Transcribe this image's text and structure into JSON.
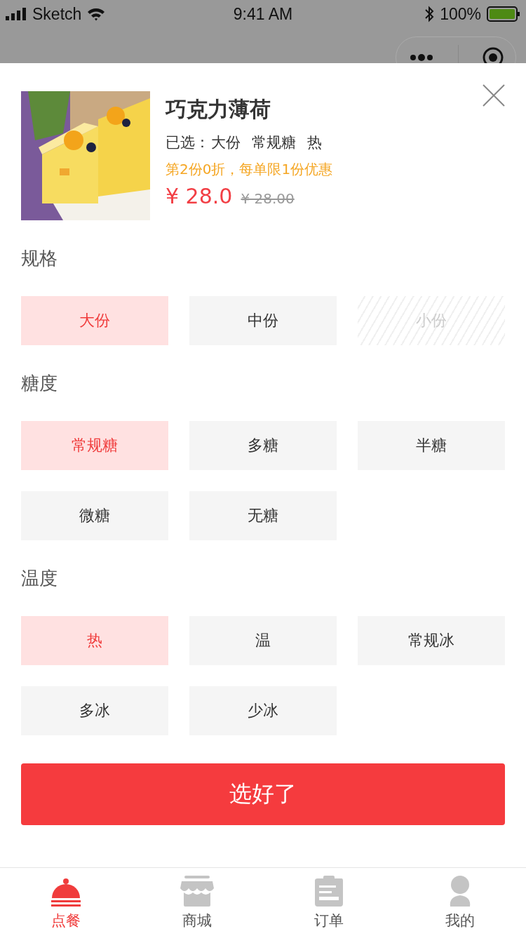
{
  "status_bar": {
    "carrier": "Sketch",
    "time": "9:41 AM",
    "battery": "100%"
  },
  "product": {
    "name": "巧克力薄荷",
    "selected_label": "已选：",
    "selected_options": [
      "大份",
      "常规糖",
      "热"
    ],
    "promo": "第2份0折，每单限1份优惠",
    "price": "¥ 28.0",
    "original_price": "¥ 28.00"
  },
  "groups": [
    {
      "title": "规格",
      "options": [
        {
          "label": "大份",
          "selected": true,
          "disabled": false
        },
        {
          "label": "中份",
          "selected": false,
          "disabled": false
        },
        {
          "label": "小份",
          "selected": false,
          "disabled": true
        }
      ]
    },
    {
      "title": "糖度",
      "options": [
        {
          "label": "常规糖",
          "selected": true,
          "disabled": false
        },
        {
          "label": "多糖",
          "selected": false,
          "disabled": false
        },
        {
          "label": "半糖",
          "selected": false,
          "disabled": false
        },
        {
          "label": "微糖",
          "selected": false,
          "disabled": false
        },
        {
          "label": "无糖",
          "selected": false,
          "disabled": false
        }
      ]
    },
    {
      "title": "温度",
      "options": [
        {
          "label": "热",
          "selected": true,
          "disabled": false
        },
        {
          "label": "温",
          "selected": false,
          "disabled": false
        },
        {
          "label": "常规冰",
          "selected": false,
          "disabled": false
        },
        {
          "label": "多冰",
          "selected": false,
          "disabled": false
        },
        {
          "label": "少冰",
          "selected": false,
          "disabled": false
        }
      ]
    }
  ],
  "confirm_button": "选好了",
  "tabs": [
    {
      "label": "点餐",
      "kind": "cloche",
      "selected": true
    },
    {
      "label": "商城",
      "kind": "shop",
      "selected": false
    },
    {
      "label": "订单",
      "kind": "clipboard",
      "selected": false
    },
    {
      "label": "我的",
      "kind": "person",
      "selected": false
    }
  ]
}
